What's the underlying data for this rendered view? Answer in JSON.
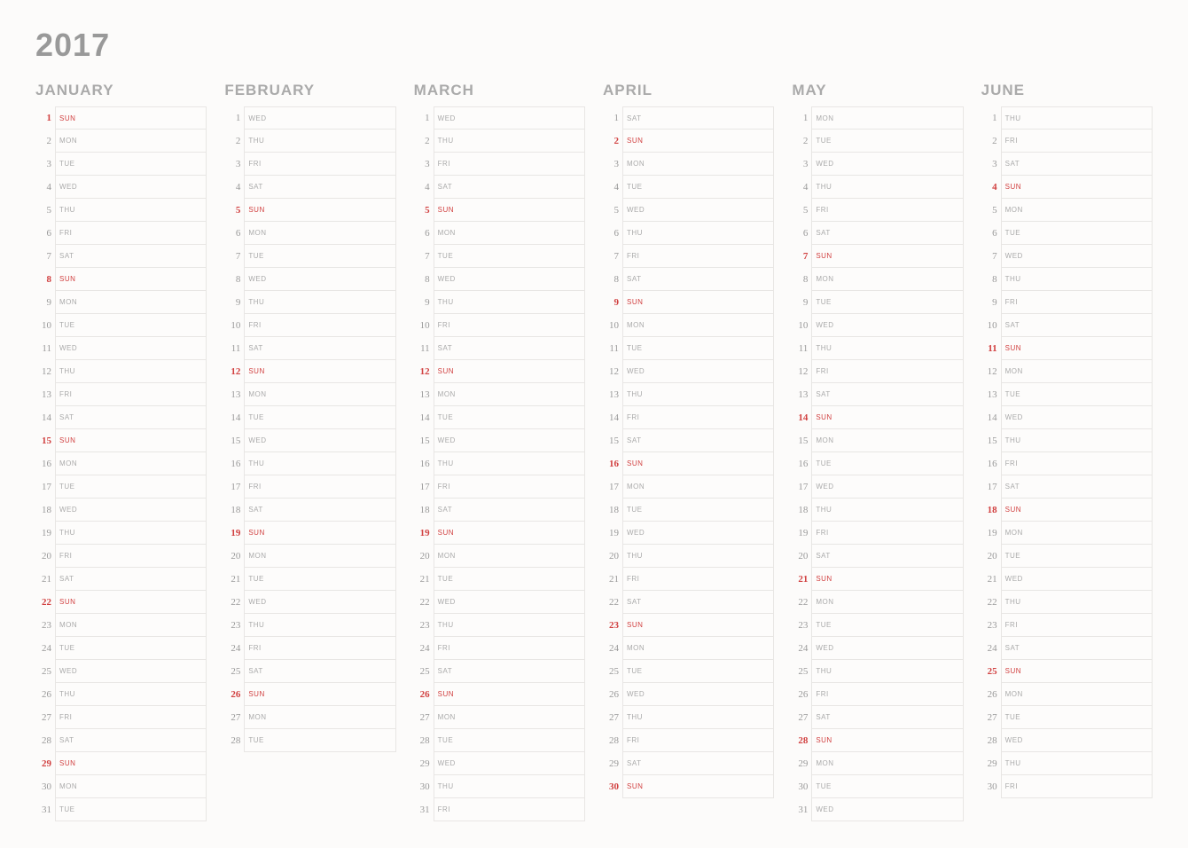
{
  "year": "2017",
  "weekdays": [
    "SUN",
    "MON",
    "TUE",
    "WED",
    "THU",
    "FRI",
    "SAT"
  ],
  "months": [
    {
      "name": "JANUARY",
      "days": 31,
      "startDow": 0
    },
    {
      "name": "FEBRUARY",
      "days": 28,
      "startDow": 3
    },
    {
      "name": "MARCH",
      "days": 31,
      "startDow": 3
    },
    {
      "name": "APRIL",
      "days": 30,
      "startDow": 6
    },
    {
      "name": "MAY",
      "days": 31,
      "startDow": 1
    },
    {
      "name": "JUNE",
      "days": 30,
      "startDow": 4
    }
  ]
}
